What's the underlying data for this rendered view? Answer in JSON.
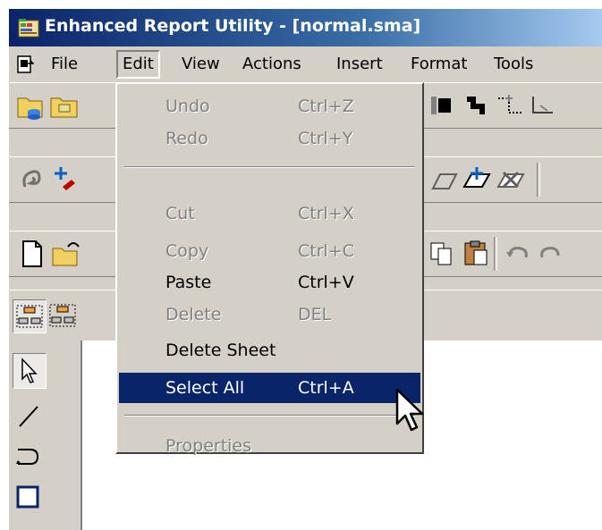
{
  "window": {
    "title": "Enhanced Report Utility - [normal.sma]"
  },
  "menubar": {
    "file": "File",
    "edit": "Edit",
    "view": "View",
    "actions": "Actions",
    "insert": "Insert",
    "format": "Format",
    "tools": "Tools"
  },
  "edit_menu": {
    "undo": {
      "label": "Undo",
      "shortcut": "Ctrl+Z"
    },
    "redo": {
      "label": "Redo",
      "shortcut": "Ctrl+Y"
    },
    "cut": {
      "label": "Cut",
      "shortcut": "Ctrl+X"
    },
    "copy": {
      "label": "Copy",
      "shortcut": "Ctrl+C"
    },
    "paste": {
      "label": "Paste",
      "shortcut": "Ctrl+V"
    },
    "delete": {
      "label": "Delete",
      "shortcut": "DEL"
    },
    "delete_sheet": {
      "label": "Delete Sheet"
    },
    "select_all": {
      "label": "Select All",
      "shortcut": "Ctrl+A"
    },
    "properties": {
      "label": "Properties"
    }
  },
  "colors": {
    "menu_highlight": "#0a246a",
    "titlebar_start": "#0a246a",
    "titlebar_end": "#a6caf0",
    "face": "#d4d0c8"
  }
}
